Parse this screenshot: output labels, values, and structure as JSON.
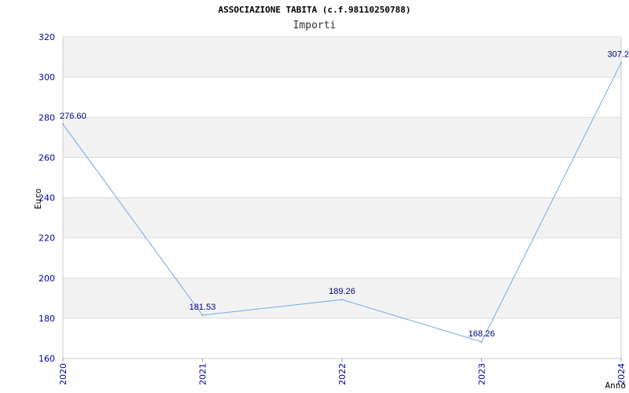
{
  "chart_data": {
    "type": "line",
    "title": "ASSOCIAZIONE TABITA (c.f.98110250788)",
    "subtitle": "Importi",
    "xlabel": "Anno",
    "ylabel": "Euro",
    "categories": [
      "2020",
      "2021",
      "2022",
      "2023",
      "2024"
    ],
    "series": [
      {
        "values": [
          276.6,
          181.53,
          189.26,
          168.26,
          307.2
        ],
        "labels": [
          "276.60",
          "181.53",
          "189.26",
          "168.26",
          "307.2"
        ]
      }
    ],
    "ylim": [
      160,
      320
    ],
    "yticks": [
      160,
      180,
      200,
      220,
      240,
      260,
      280,
      300,
      320
    ],
    "grid": true,
    "line_color": "#6fa8e8",
    "band_color": "#f2f2f2",
    "tick_color": "#0000aa",
    "label_color": "#000080"
  }
}
